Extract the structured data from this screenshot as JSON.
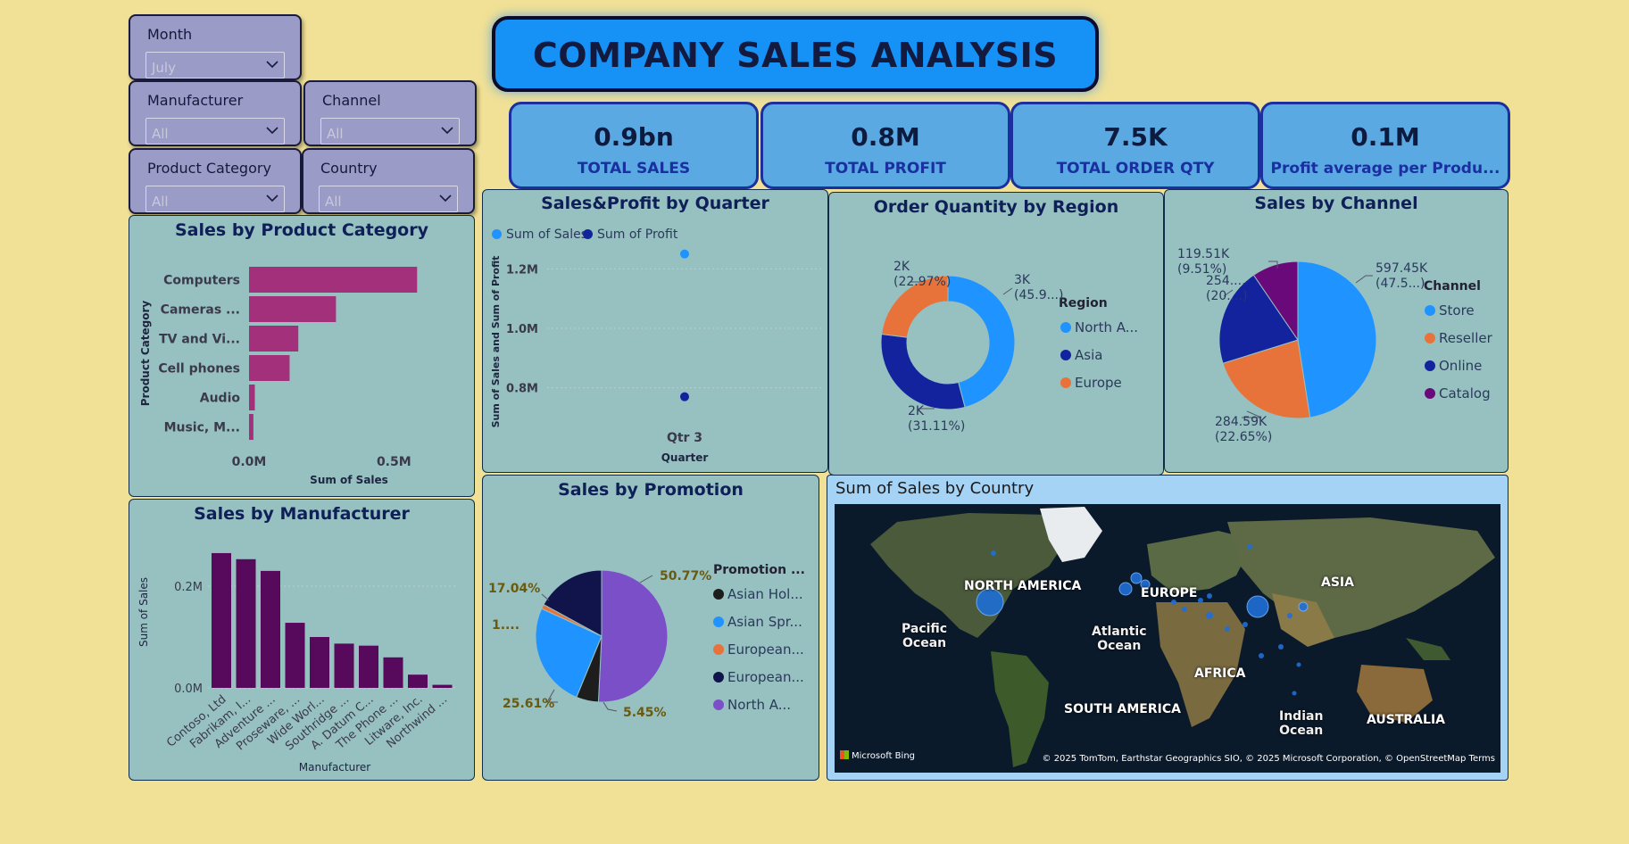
{
  "title": "COMPANY SALES ANALYSIS",
  "slicers": {
    "month": {
      "label": "Month",
      "value": "July"
    },
    "manufacturer": {
      "label": "Manufacturer",
      "value": "All"
    },
    "channel": {
      "label": "Channel",
      "value": "All"
    },
    "product_category": {
      "label": "Product Category",
      "value": "All"
    },
    "country": {
      "label": "Country",
      "value": "All"
    }
  },
  "kpis": [
    {
      "value": "0.9bn",
      "label": "TOTAL SALES"
    },
    {
      "value": "0.8M",
      "label": "TOTAL PROFIT"
    },
    {
      "value": "7.5K",
      "label": "TOTAL ORDER QTY"
    },
    {
      "value": "0.1M",
      "label": "Profit average per Produ..."
    }
  ],
  "colors": {
    "magenta": "#a3307a",
    "purple": "#570a5c",
    "blue": "#1f93ff",
    "navy": "#13239e",
    "orange": "#e8733a",
    "dark_purple": "#6a0a7a",
    "violet": "#7b4fc8",
    "black": "#1d1d1d",
    "dark_navy": "#10144a"
  },
  "chart_data": [
    {
      "type": "bar",
      "orientation": "horizontal",
      "title": "Sales by Product Category",
      "xlabel": "Sum of Sales",
      "ylabel": "Product Category",
      "categories": [
        "Computers",
        "Cameras ...",
        "TV and Vi...",
        "Cell phones",
        "Audio",
        "Music, M..."
      ],
      "values": [
        0.58,
        0.3,
        0.17,
        0.14,
        0.02,
        0.015
      ],
      "xticks": [
        "0.0M",
        "0.5M"
      ],
      "xlim": [
        0,
        0.65
      ]
    },
    {
      "type": "bar",
      "title": "Sales by Manufacturer",
      "xlabel": "Manufacturer",
      "ylabel": "Sum of Sales",
      "categories": [
        "Contoso, Ltd",
        "Fabrikam, I...",
        "Adventure ...",
        "Proseware, ...",
        "Wide Worl...",
        "Southridge ...",
        "A. Datum C...",
        "The Phone ...",
        "Litware, Inc.",
        "Northwind ..."
      ],
      "values": [
        0.265,
        0.253,
        0.23,
        0.128,
        0.1,
        0.087,
        0.083,
        0.06,
        0.026,
        0.006
      ],
      "yticks": [
        "0.0M",
        "0.2M"
      ],
      "ylim": [
        0,
        0.3
      ]
    },
    {
      "type": "scatter",
      "title": "Sales&Profit by Quarter",
      "xlabel": "Quarter",
      "ylabel": "Sum of Sales and Sum of Profit",
      "categories": [
        "Qtr 3"
      ],
      "series": [
        {
          "name": "Sum of Sales",
          "values": [
            1.25
          ]
        },
        {
          "name": "Sum of Profit",
          "values": [
            0.77
          ]
        }
      ],
      "yticks": [
        "0.8M",
        "1.0M",
        "1.2M"
      ],
      "ylim": [
        0.7,
        1.3
      ]
    },
    {
      "type": "pie",
      "hole": true,
      "title": "Order Quantity by Region",
      "legend_title": "Region",
      "slices": [
        {
          "name": "North A...",
          "value": 45.9,
          "label": "3K",
          "pct": "(45.9...)"
        },
        {
          "name": "Asia",
          "value": 31.11,
          "label": "2K",
          "pct": "(31.11%)"
        },
        {
          "name": "Europe",
          "value": 22.97,
          "label": "2K",
          "pct": "(22.97%)"
        }
      ]
    },
    {
      "type": "pie",
      "title": "Sales by Channel",
      "legend_title": "Channel",
      "slices": [
        {
          "name": "Store",
          "value": 47.5,
          "label": "597.45K",
          "pct": "(47.5...)"
        },
        {
          "name": "Reseller",
          "value": 22.65,
          "label": "284.59K",
          "pct": "(22.65%)"
        },
        {
          "name": "Online",
          "value": 20.3,
          "label": "254....",
          "pct": "(20....)"
        },
        {
          "name": "Catalog",
          "value": 9.51,
          "label": "119.51K",
          "pct": "(9.51%)"
        }
      ]
    },
    {
      "type": "pie",
      "title": "Sales by Promotion",
      "legend_title": "Promotion ...",
      "slices": [
        {
          "name": "North A...",
          "value": 50.77,
          "label": "50.77%"
        },
        {
          "name": "Asian Hol...",
          "value": 5.45,
          "label": "5.45%"
        },
        {
          "name": "Asian Spr...",
          "value": 25.61,
          "label": "25.61%"
        },
        {
          "name": "European...",
          "value": 1.13,
          "label": "1...."
        },
        {
          "name": "European...",
          "value": 17.04,
          "label": "17.04%"
        }
      ]
    }
  ],
  "map": {
    "title": "Sum of Sales by Country",
    "labels": {
      "north_america": "NORTH AMERICA",
      "europe": "EUROPE",
      "asia": "ASIA",
      "africa": "AFRICA",
      "south_america": "SOUTH AMERICA",
      "australia": "AUSTRALIA",
      "pacific": "Pacific\nOcean",
      "atlantic": "Atlantic\nOcean",
      "indian": "Indian\nOcean"
    },
    "attribution": "© 2025 TomTom, Earthstar Geographics SIO, © 2025 Microsoft Corporation, © OpenStreetMap  Terms",
    "brand": "Microsoft Bing"
  }
}
